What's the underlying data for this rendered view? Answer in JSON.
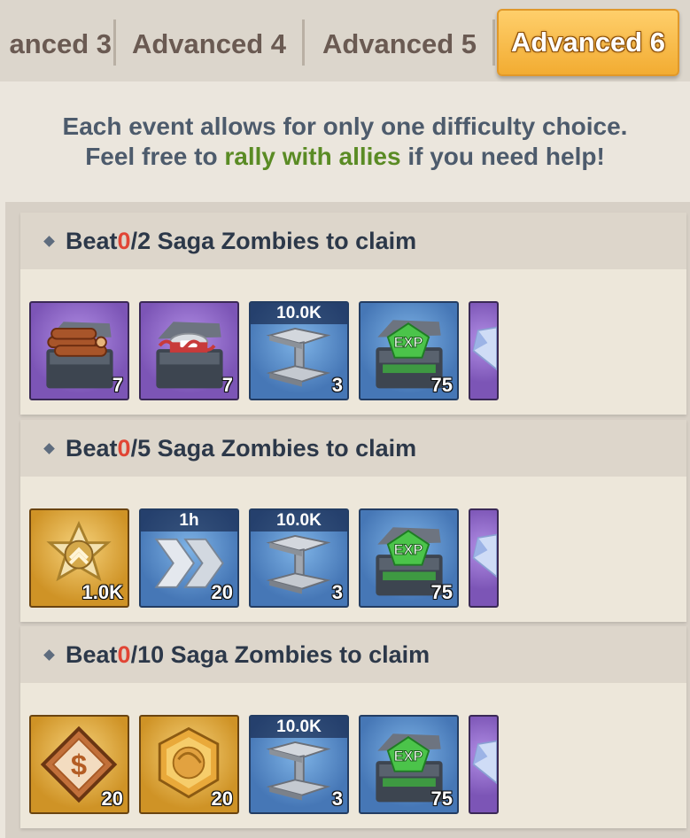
{
  "tabs": [
    {
      "label": "anced 3",
      "active": false
    },
    {
      "label": "Advanced 4",
      "active": false
    },
    {
      "label": "Advanced 5",
      "active": false
    },
    {
      "label": "Advanced 6",
      "active": true
    }
  ],
  "notice": {
    "line1": "Each event allows for only one difficulty choice.",
    "line2_pre": "Feel free to ",
    "line2_highlight": "rally with allies",
    "line2_post": " if you need help!"
  },
  "tasks": [
    {
      "prefix": "Beat ",
      "progress": "0",
      "target": "/2 Saga Zombies to claim",
      "rewards": [
        {
          "icon": "wood-chest-icon",
          "top_label": "",
          "qty": "7"
        },
        {
          "icon": "food-chest-icon",
          "top_label": "",
          "qty": "7"
        },
        {
          "icon": "steel-beam-icon",
          "top_label": "10.0K",
          "qty": "3"
        },
        {
          "icon": "exp-chest-icon",
          "top_label": "",
          "qty": "75"
        },
        {
          "icon": "diamond-icon",
          "top_label": "",
          "qty": ""
        }
      ]
    },
    {
      "prefix": "Beat ",
      "progress": "0",
      "target": "/5 Saga Zombies to claim",
      "rewards": [
        {
          "icon": "sheriff-badge-icon",
          "top_label": "",
          "qty": "1.0K"
        },
        {
          "icon": "speedup-icon",
          "top_label": "1h",
          "qty": "20"
        },
        {
          "icon": "steel-beam-icon",
          "top_label": "10.0K",
          "qty": "3"
        },
        {
          "icon": "exp-chest-icon",
          "top_label": "",
          "qty": "75"
        },
        {
          "icon": "diamond-icon",
          "top_label": "",
          "qty": ""
        }
      ]
    },
    {
      "prefix": "Beat ",
      "progress": "0",
      "target": "/10 Saga Zombies to claim",
      "rewards": [
        {
          "icon": "skill-token-icon",
          "top_label": "",
          "qty": "20"
        },
        {
          "icon": "hero-medal-icon",
          "top_label": "",
          "qty": "20"
        },
        {
          "icon": "steel-beam-icon",
          "top_label": "10.0K",
          "qty": "3"
        },
        {
          "icon": "exp-chest-icon",
          "top_label": "",
          "qty": "75"
        },
        {
          "icon": "diamond-icon",
          "top_label": "",
          "qty": ""
        }
      ]
    }
  ]
}
